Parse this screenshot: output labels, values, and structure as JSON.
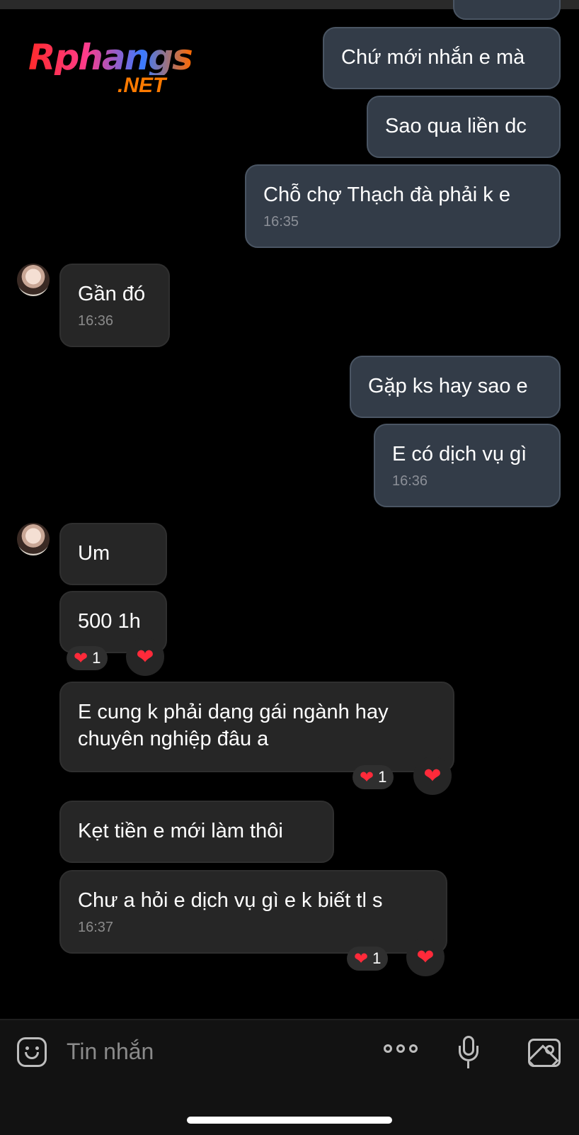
{
  "watermark": {
    "line1": "Rphangs",
    "line2": ".NET"
  },
  "messages": [
    {
      "direction": "outgoing",
      "text": "Chứ mới nhắn e mà",
      "time": ""
    },
    {
      "direction": "outgoing",
      "text": "Sao qua liền dc",
      "time": ""
    },
    {
      "direction": "outgoing",
      "text": "Chỗ chợ Thạch đà phải k e",
      "time": "16:35"
    },
    {
      "direction": "incoming",
      "text": "Gần đó",
      "time": "16:36"
    },
    {
      "direction": "outgoing",
      "text": "Gặp ks hay sao e",
      "time": ""
    },
    {
      "direction": "outgoing",
      "text": "E có dịch vụ gì",
      "time": "16:36"
    },
    {
      "direction": "incoming",
      "text": "Um",
      "time": ""
    },
    {
      "direction": "incoming",
      "text": "500 1h",
      "time": "",
      "reaction_count": "1"
    },
    {
      "direction": "incoming",
      "text_line1": "E cung k phải dạng gái ngành hay",
      "text_line2": "chuyên nghiệp đâu a",
      "time": "",
      "reaction_count": "1"
    },
    {
      "direction": "incoming",
      "text": "Kẹt tiền e mới làm thôi",
      "time": ""
    },
    {
      "direction": "incoming",
      "text": "Chư a hỏi e dịch vụ gì e k biết tl s",
      "time": "16:37",
      "reaction_count": "1"
    }
  ],
  "reaction": {
    "heart": "❤"
  },
  "composer": {
    "placeholder": "Tin nhắn"
  },
  "icons": [
    "emoji-icon",
    "more-options-icon",
    "microphone-icon",
    "image-icon",
    "heart-icon"
  ],
  "colors": {
    "outgoing_bubble": "#333c48",
    "incoming_bubble": "#262626",
    "heart": "#ff2a3a"
  }
}
